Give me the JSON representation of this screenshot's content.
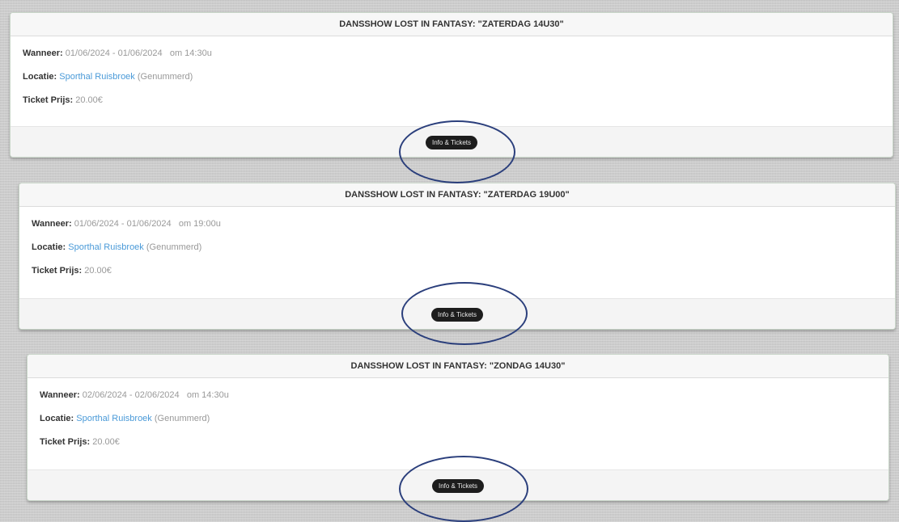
{
  "events": [
    {
      "title": "DANSSHOW LOST IN FANTASY: \"ZATERDAG 14U30\"",
      "when_label": "Wanneer:",
      "when_value": "01/06/2024 - 01/06/2024   om 14:30u",
      "location_label": "Locatie:",
      "location_link": "Sporthal Ruisbroek",
      "location_note": " (Genummerd)",
      "price_label": "Ticket Prijs:",
      "price_value": "20.00€",
      "button_label": "Info & Tickets"
    },
    {
      "title": "DANSSHOW LOST IN FANTASY: \"ZATERDAG 19U00\"",
      "when_label": "Wanneer:",
      "when_value": "01/06/2024 - 01/06/2024   om 19:00u",
      "location_label": "Locatie:",
      "location_link": "Sporthal Ruisbroek",
      "location_note": " (Genummerd)",
      "price_label": "Ticket Prijs:",
      "price_value": "20.00€",
      "button_label": "Info & Tickets"
    },
    {
      "title": "DANSSHOW LOST IN FANTASY: \"ZONDAG 14U30\"",
      "when_label": "Wanneer:",
      "when_value": "02/06/2024 - 02/06/2024   om 14:30u",
      "location_label": "Locatie:",
      "location_link": "Sporthal Ruisbroek",
      "location_note": " (Genummerd)",
      "price_label": "Ticket Prijs:",
      "price_value": "20.00€",
      "button_label": "Info & Tickets"
    }
  ],
  "colors": {
    "link": "#4a9ad8",
    "button_bg": "#1d1d1d",
    "annotation_ring": "#2b3f7c"
  }
}
